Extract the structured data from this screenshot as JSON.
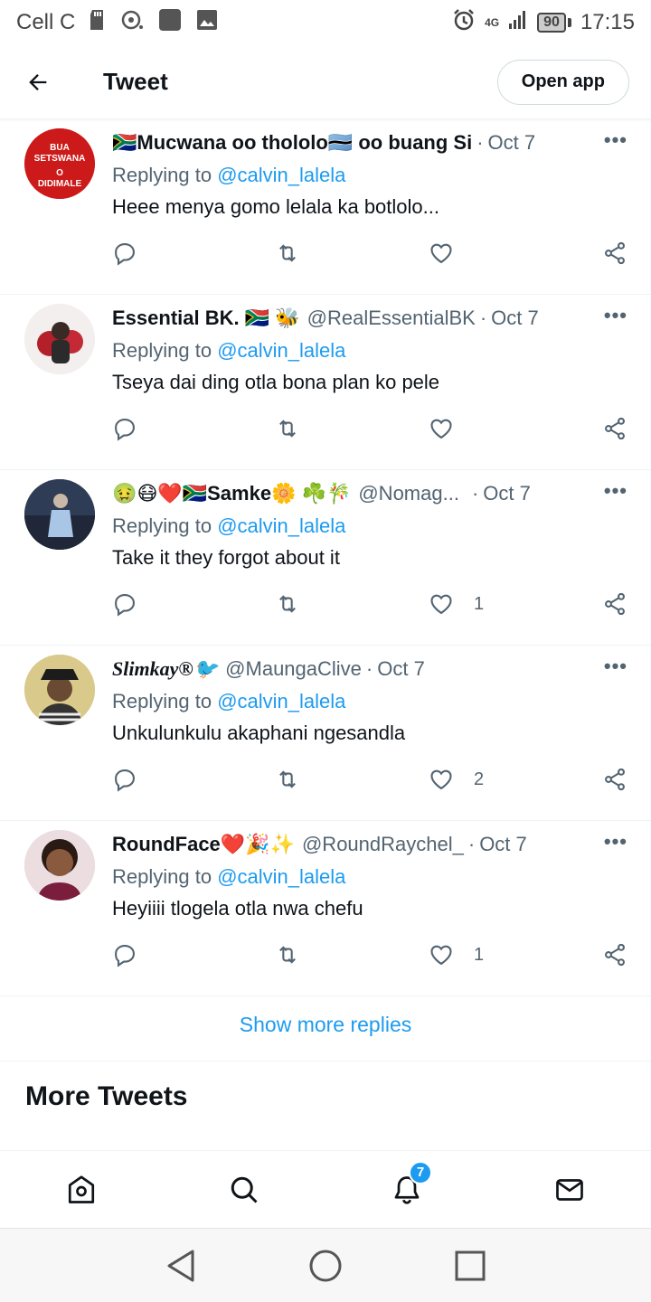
{
  "status_bar": {
    "carrier": "Cell C",
    "network": "4G",
    "battery": "90",
    "time": "17:15"
  },
  "header": {
    "title": "Tweet",
    "open_app_label": "Open app"
  },
  "replies": [
    {
      "name": "🇿🇦Mucwana oo thololo🇧🇼 oo buang Si",
      "handle": "",
      "date": "Oct 7",
      "replying_prefix": "Replying to",
      "replying_to": "@calvin_lalela",
      "text": "Heee menya gomo lelala ka botlolo...",
      "likes": "",
      "avatar_text": [
        "BUA",
        "SETSWANA",
        "O",
        "DIDIMALE"
      ]
    },
    {
      "name": "Essential BK. 🇿🇦 🐝",
      "handle": "@RealEssentialBK",
      "date": "Oct 7",
      "replying_prefix": "Replying to",
      "replying_to": "@calvin_lalela",
      "text": "Tseya dai ding otla bona plan ko pele",
      "likes": ""
    },
    {
      "name": "🤢😷❤️🇿🇦Samke🌼 ☘️🎋",
      "handle": "@Nomag...",
      "date": "Oct 7",
      "replying_prefix": "Replying to",
      "replying_to": "@calvin_lalela",
      "text": "Take it they forgot about it",
      "likes": "1"
    },
    {
      "name": "Slimkay®🐦",
      "handle": "@MaungaClive",
      "date": "Oct 7",
      "replying_prefix": "Replying to",
      "replying_to": "@calvin_lalela",
      "text": "Unkulunkulu akaphani ngesandla",
      "likes": "2"
    },
    {
      "name": "RoundFace❤️🎉✨",
      "handle": "@RoundRaychel_",
      "date": "Oct 7",
      "replying_prefix": "Replying to",
      "replying_to": "@calvin_lalela",
      "text": "Heyiiii tlogela otla nwa chefu",
      "likes": "1"
    }
  ],
  "show_more_label": "Show more replies",
  "more_tweets_title": "More Tweets",
  "tabbar": {
    "notifications_badge": "7"
  },
  "icons": [
    "back-arrow-icon",
    "reply-icon",
    "retweet-icon",
    "like-icon",
    "share-icon",
    "home-icon",
    "search-icon",
    "notifications-icon",
    "messages-icon"
  ],
  "colors": {
    "accent": "#1d9bf0",
    "muted": "#536471",
    "text": "#0f1419"
  }
}
